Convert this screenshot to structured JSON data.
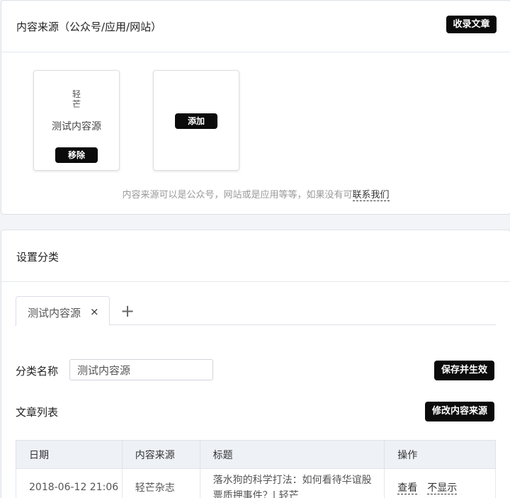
{
  "source_panel": {
    "title": "内容来源（公众号/应用/网站）",
    "collect_button": "收录文章",
    "sources": [
      {
        "logo_line1": "轻",
        "logo_line2": "芒",
        "name": "测试内容源",
        "remove_label": "移除"
      }
    ],
    "add_label": "添加",
    "hint_text": "内容来源可以是公众号，网站或是应用等等，如果没有可",
    "hint_link": "联系我们"
  },
  "category_panel": {
    "title": "设置分类",
    "tabs": [
      {
        "label": "测试内容源",
        "close": "×"
      }
    ],
    "add_tab": "+",
    "name_label": "分类名称",
    "name_value": "测试内容源",
    "save_button": "保存并生效",
    "article_list_label": "文章列表",
    "modify_button": "修改内容来源",
    "table": {
      "headers": [
        "日期",
        "内容来源",
        "标题",
        "操作"
      ],
      "rows": [
        {
          "date": "2018-06-12 21:06",
          "source": "轻芒杂志",
          "title": "落水狗的科学打法：如何看待华谊股票质押事件？| 轻芒",
          "op_view": "查看",
          "op_hide": "不显示"
        }
      ]
    }
  }
}
